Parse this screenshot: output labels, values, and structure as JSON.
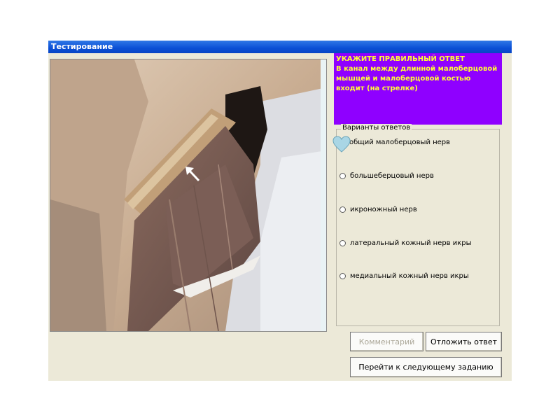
{
  "window": {
    "title": "Тестирование"
  },
  "question": {
    "heading": "УКАЖИТЕ ПРАВИЛЬНЫЙ ОТВЕТ",
    "text": "В канал между длинной малоберцовой мышцей и малоберцовой костью входит (на стрелке)"
  },
  "answers": {
    "legend": "Варианты ответов",
    "options": [
      "общий малоберцовый нерв",
      "большеберцовый нерв",
      "икроножный нерв",
      "латеральный кожный нерв икры",
      "медиальный кожный нерв икры"
    ]
  },
  "buttons": {
    "comment": "Комментарий",
    "postpone": "Отложить ответ",
    "next": "Перейти к следующему заданию"
  },
  "colors": {
    "question_bg": "#8f00ff",
    "question_text": "#ffff33",
    "title_bar": "#0a4fd6",
    "heart": "#a9d6e5"
  },
  "icons": {
    "selected_marker": "heart-icon",
    "image_arrow": "arrow-icon"
  }
}
